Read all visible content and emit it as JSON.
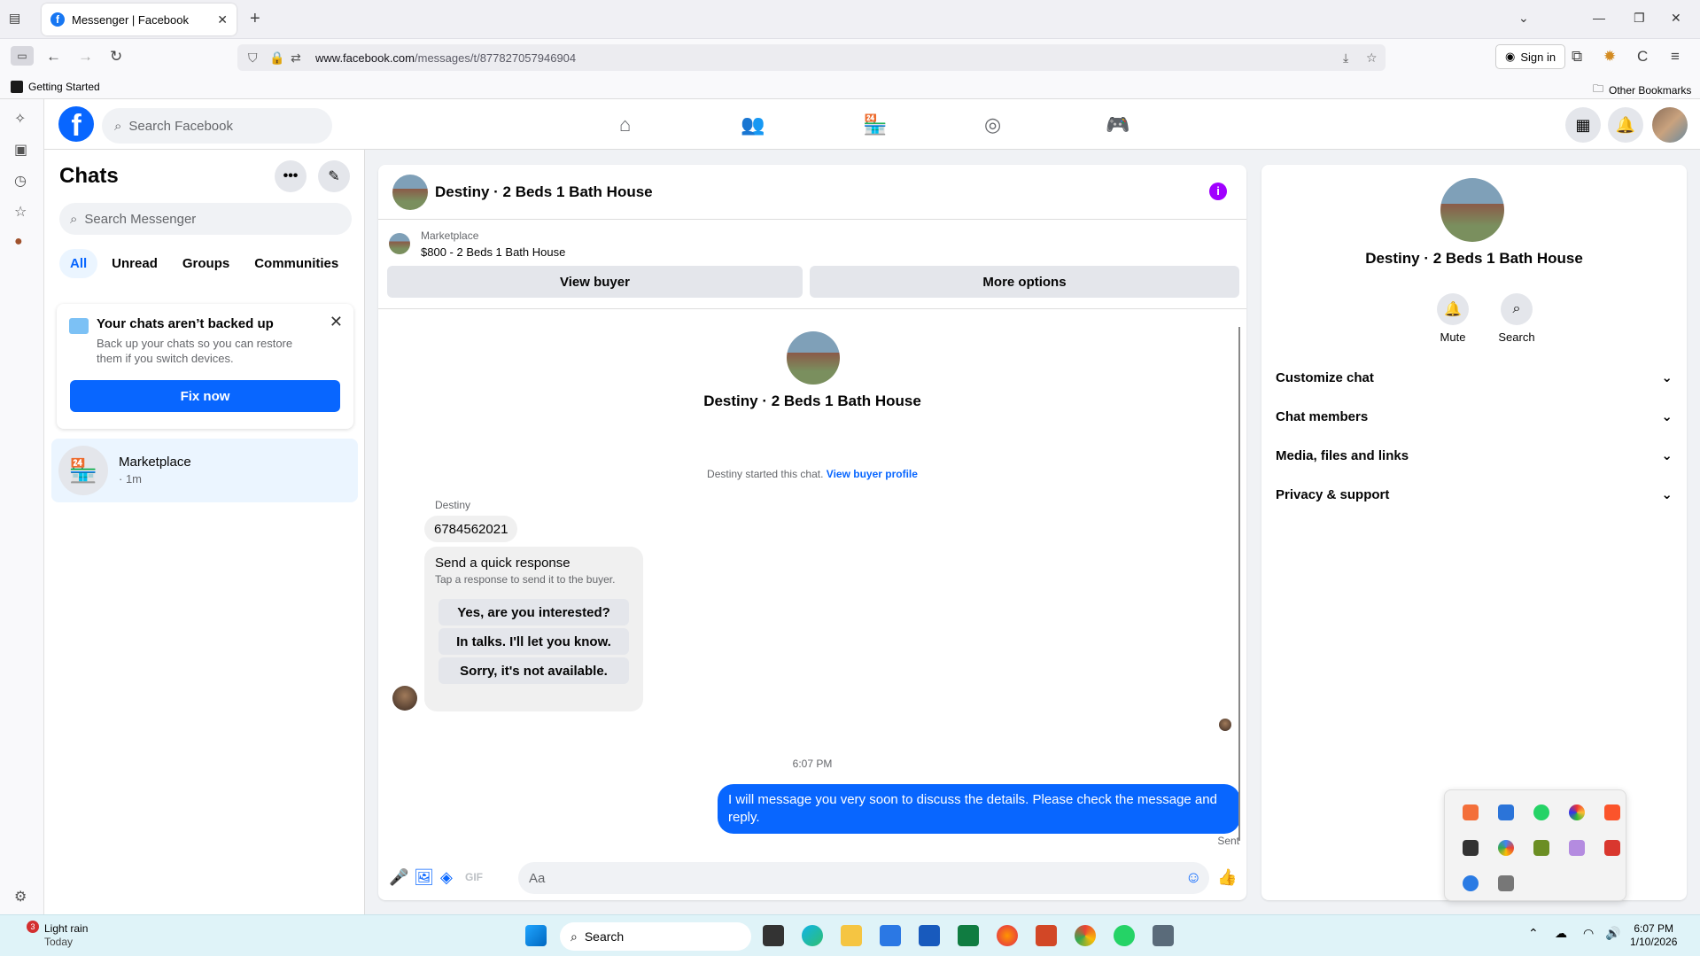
{
  "browser": {
    "tab_title": "Messenger | Facebook",
    "url_domain": "www.facebook.com",
    "url_path": "/messages/t/877827057946904",
    "sign_in": "Sign in",
    "bookmark_getting_started": "Getting Started",
    "bookmark_other": "Other Bookmarks"
  },
  "facebook": {
    "search_placeholder": "Search Facebook"
  },
  "chats": {
    "title": "Chats",
    "search_placeholder": "Search Messenger",
    "filters": [
      "All",
      "Unread",
      "Groups",
      "Communities"
    ],
    "backup": {
      "title": "Your chats aren’t backed up",
      "desc": "Back up your chats so you can restore them if you switch devices.",
      "button": "Fix now"
    },
    "conversation": {
      "name": "Marketplace",
      "time": "· 1m"
    }
  },
  "conversation": {
    "title": "Destiny · 2 Beds 1 Bath House",
    "marketplace_label": "Marketplace",
    "listing": "$800 - 2 Beds 1 Bath House",
    "view_buyer": "View buyer",
    "more_options": "More options",
    "started_text": "Destiny started this chat.",
    "view_profile": "View buyer profile",
    "sender": "Destiny",
    "incoming": "6784562021",
    "quick_title": "Send a quick response",
    "quick_desc": "Tap a response to send it to the buyer.",
    "quick_responses": [
      "Yes, are you interested?",
      "In talks. I'll let you know.",
      "Sorry, it's not available."
    ],
    "timestamp": "6:07 PM",
    "outgoing": "I will message you very soon to discuss the details. Please check the message and reply.",
    "sent": "Sent",
    "composer_placeholder": "Aa"
  },
  "details": {
    "name": "Destiny · 2 Beds 1 Bath House",
    "actions": [
      "Mute",
      "Search"
    ],
    "sections": [
      "Customize chat",
      "Chat members",
      "Media, files and links",
      "Privacy & support"
    ]
  },
  "taskbar": {
    "weather_title": "Light rain",
    "weather_sub": "Today",
    "weather_badge": "3",
    "search": "Search",
    "time": "6:07 PM",
    "date": "1/10/2026"
  },
  "colors": {
    "accent": "#0866ff",
    "info": "#a000ff"
  }
}
